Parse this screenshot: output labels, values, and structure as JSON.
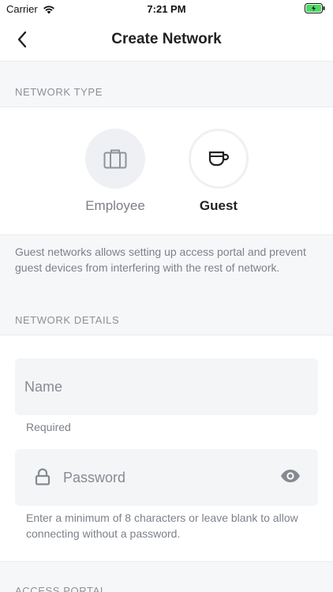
{
  "status_bar": {
    "carrier": "Carrier",
    "time": "7:21 PM"
  },
  "nav": {
    "title": "Create Network"
  },
  "network_type": {
    "header": "NETWORK TYPE",
    "options": [
      {
        "label": "Employee",
        "icon": "briefcase-icon",
        "selected": false
      },
      {
        "label": "Guest",
        "icon": "coffee-cup-icon",
        "selected": true
      }
    ],
    "description": "Guest networks allows setting up access portal and prevent guest devices from interfering with the rest of network."
  },
  "network_details": {
    "header": "NETWORK DETAILS",
    "name_field": {
      "placeholder": "Name",
      "helper": "Required"
    },
    "password_field": {
      "placeholder": "Password",
      "helper": "Enter a minimum of 8 characters or leave blank to allow connecting without a password."
    }
  },
  "access_portal": {
    "header": "ACCESS PORTAL"
  },
  "colors": {
    "background": "#f6f7f9",
    "card": "#ffffff",
    "field": "#f4f5f7",
    "muted_text": "#7c8189",
    "battery": "#4cd964"
  }
}
